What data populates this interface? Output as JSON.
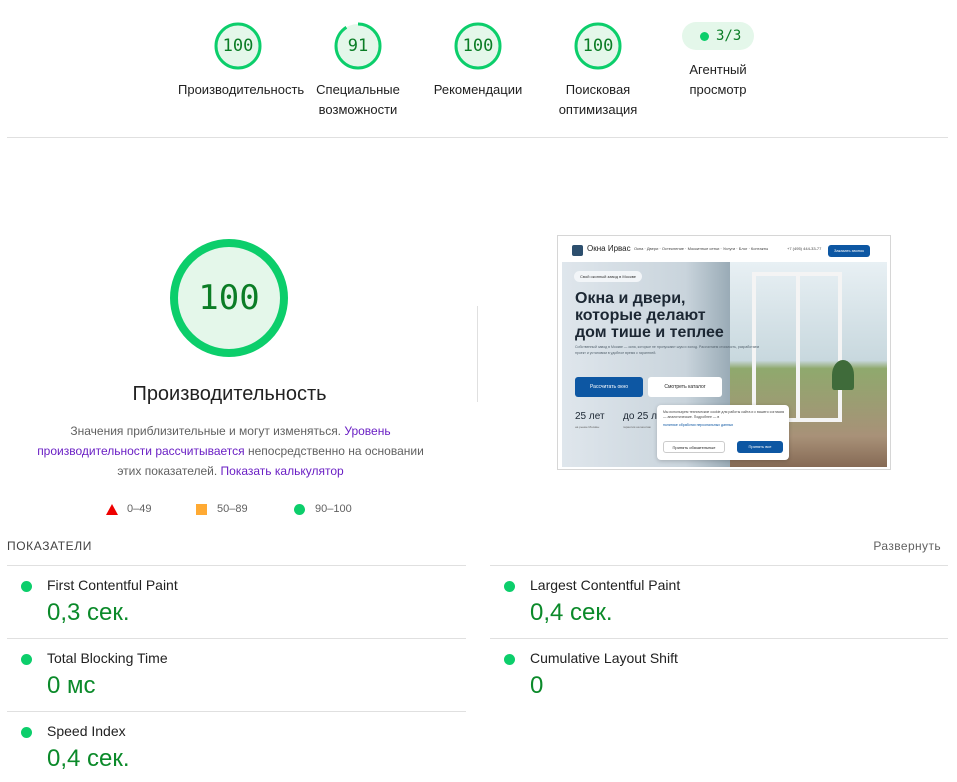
{
  "summary_scores": [
    {
      "score": "100",
      "label": "Производительность",
      "value": 100
    },
    {
      "score": "91",
      "label": "Специальные возможности",
      "value": 91
    },
    {
      "score": "100",
      "label": "Рекомендации",
      "value": 100
    },
    {
      "score": "100",
      "label": "Поисковая оптимизация",
      "value": 100
    }
  ],
  "agent": {
    "score": "3/3",
    "label": "Агентный просмотр"
  },
  "performance": {
    "score": "100",
    "value": 100,
    "title": "Производительность",
    "desc_prefix": "Значения приблизительные и могут изменяться.",
    "desc_link": "Уровень производительности рассчитывается",
    "desc_middle": "непосредственно на основании этих показателей.",
    "calc_link": "Показать калькулятор"
  },
  "legend": [
    {
      "shape": "triangle",
      "range": "0–49",
      "color": "#ee0000"
    },
    {
      "shape": "square",
      "range": "50–89",
      "color": "#ffaa33"
    },
    {
      "shape": "circle",
      "range": "90–100",
      "color": "#0cce6b"
    }
  ],
  "screenshot": {
    "brand": "Окна Ирвас",
    "menu": "Окна · Двери · Остекление · Москитные сетки · Услуги · Блог · Контакты",
    "phone": "+7 (495) 444-33-77",
    "call": "Заказать звонок",
    "badge": "Свой оконный завод в Москве",
    "headline": "Окна и двери, которые делают дом тише и теплее",
    "paragraph": "Собственный завод в Москве — окна, которые не пропускают шум и холод. Рассчитаем стоимость, разработаем проект и установим в удобное время с гарантией.",
    "primary_btn": "Рассчитать окно",
    "secondary_btn": "Смотреть каталог",
    "stat1": "25 лет",
    "stat1_sub": "на рынке Москвы",
    "stat2": "до 25 л",
    "stat2_sub": "гарантия на монтаж",
    "cookie_text": "Мы используем технические cookie для работы сайта и с вашего согласия — аналитические. Подробнее — в",
    "cookie_link": "политике обработки персональных данных",
    "cookie_btn1": "Принять обязательные",
    "cookie_btn2": "Принять все"
  },
  "metrics": {
    "title": "ПОКАЗАТЕЛИ",
    "expand": "Развернуть",
    "items": [
      {
        "name": "First Contentful Paint",
        "value": "0,3 сек."
      },
      {
        "name": "Largest Contentful Paint",
        "value": "0,4 сек."
      },
      {
        "name": "Total Blocking Time",
        "value": "0 мс"
      },
      {
        "name": "Cumulative Layout Shift",
        "value": "0"
      },
      {
        "name": "Speed Index",
        "value": "0,4 сек."
      }
    ]
  },
  "colors": {
    "pass": "#0cce6b",
    "pass_text": "#0b8a2a",
    "pass_fill": "#e4f7ea",
    "link": "#6a1fc4"
  }
}
